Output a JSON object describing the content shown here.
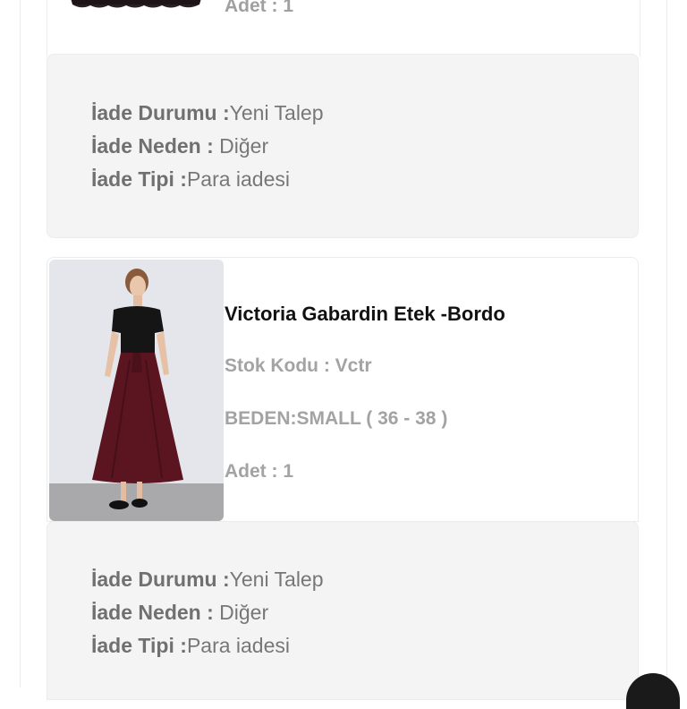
{
  "top_item": {
    "quantity_text": "Adet : 1"
  },
  "return_status_1": {
    "status_label": "İade Durumu :",
    "status_value": "Yeni Talep",
    "reason_label": "İade Neden : ",
    "reason_value": "Diğer",
    "type_label": "İade Tipi :",
    "type_value": "Para iadesi"
  },
  "product": {
    "title": "Victoria Gabardin Etek -Bordo",
    "stock_code": "Stok Kodu : Vctr",
    "size": "BEDEN:SMALL ( 36 - 38 )",
    "quantity": "Adet : 1",
    "image_icon": "product-photo-skirt-burgundy"
  },
  "return_status_2": {
    "status_label": "İade Durumu :",
    "status_value": "Yeni Talep",
    "reason_label": "İade Neden : ",
    "reason_value": "Diğer",
    "type_label": "İade Tipi :",
    "type_value": "Para iadesi"
  },
  "colors": {
    "skirt": "#5a1520",
    "panel_bg": "#f4f4f4",
    "label_gray": "#a3a3a3"
  }
}
